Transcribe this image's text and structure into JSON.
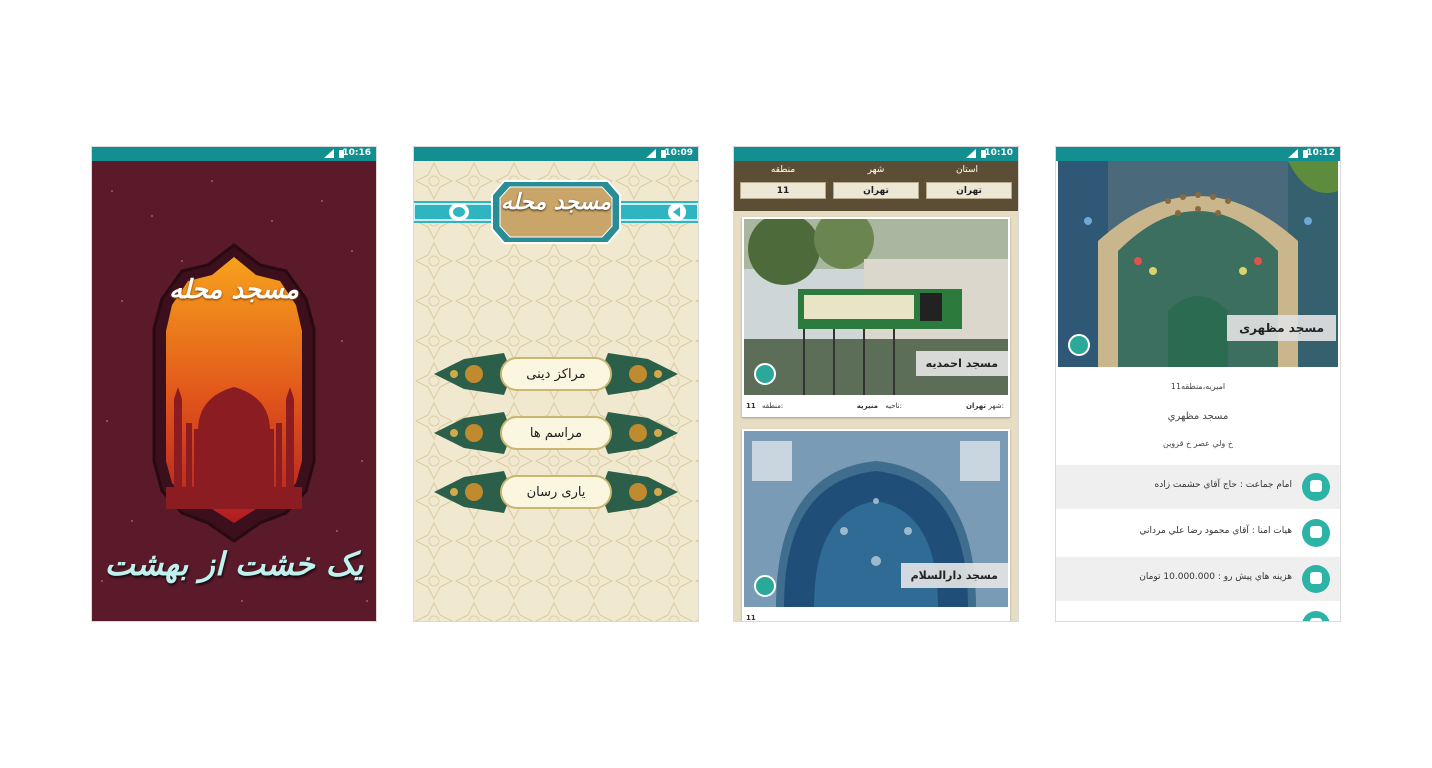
{
  "screens": [
    {
      "time": "10:16",
      "logo": "مسجد محله",
      "tagline": "یک خشت از بهشت"
    },
    {
      "time": "10:09",
      "logo": "مسجد محله",
      "menu": [
        "مراکز دینی",
        "مراسم ها",
        "یاری رسان"
      ]
    },
    {
      "time": "10:10",
      "filters": {
        "labels": [
          "استان",
          "شهر",
          "منطقه"
        ],
        "values": [
          "تهران",
          "تهران",
          "11"
        ]
      },
      "cards": [
        {
          "name": "مسجد احمدیه",
          "city_label": "شهر:",
          "city": "تهران",
          "district_label": "ناحیه:",
          "district": "منیریه",
          "region_label": "منطقه:",
          "region": "11"
        },
        {
          "name": "مسجد دارالسلام",
          "region": "11"
        }
      ]
    },
    {
      "time": "10:12",
      "title": "مسجد مظهری",
      "address_area": "امیریه،منطقه11",
      "mosque_name": "مسجد مظهري",
      "street": "خ ولي عصر خ قزوين",
      "rows": [
        {
          "label": "امام جماعت",
          "sep": ":",
          "value": "حاج آقاي حشمت زاده"
        },
        {
          "label": "هيات امنا",
          "sep": ":",
          "value": "آقاي محمود رضا علي مرداني"
        },
        {
          "label": "هزينه هاي پيش رو",
          "sep": ":",
          "value": "10.000.000 تومان"
        }
      ]
    }
  ],
  "colors": {
    "statusbar": "#138f92",
    "splash_bg": "#5a1a2a",
    "teal": "#2bb3a5",
    "filter_bar": "#5c4e35"
  }
}
